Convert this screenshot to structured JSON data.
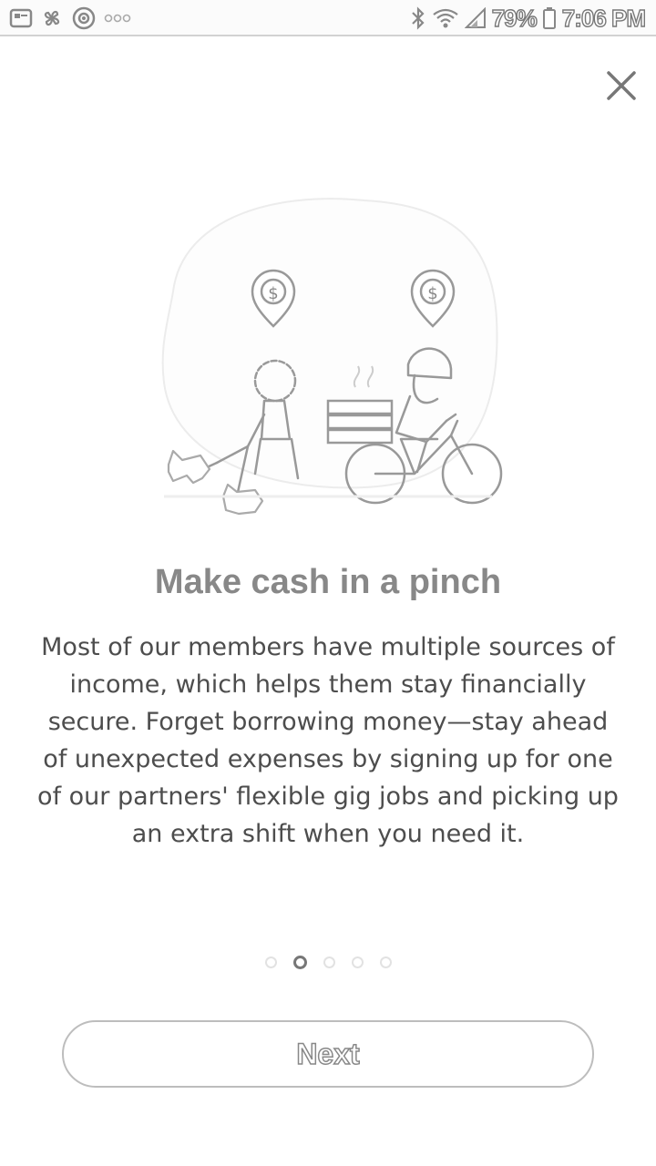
{
  "status_bar": {
    "battery": "79%",
    "time": "7:06 PM",
    "icons": [
      "image-notification-icon",
      "pinwheel-icon",
      "target-icon",
      "more-dots-icon",
      "bluetooth-icon",
      "wifi-icon",
      "signal-icon",
      "battery-icon"
    ]
  },
  "onboarding": {
    "close_icon": "close-icon",
    "title": "Make cash in a pinch",
    "body": "Most of our members have multiple sources of income, which helps them stay financially secure. Forget borrowing money—stay ahead of unexpected expenses by signing up for one of our partners' flexible gig jobs and picking up an extra shift when you need it.",
    "page_indicator": {
      "total": 5,
      "current": 2
    },
    "next_label": "Next"
  },
  "colors": {
    "text": "#4d4d4d",
    "title": "#888888",
    "button_border": "#bdbdbd"
  }
}
